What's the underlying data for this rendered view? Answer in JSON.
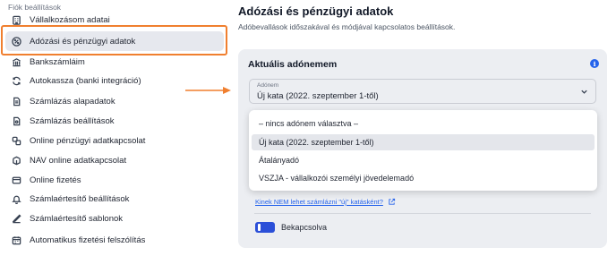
{
  "sidebar": {
    "section_title": "Fiók beállítások",
    "items": [
      {
        "label": "Vállalkozásom adatai",
        "icon": "building-icon"
      },
      {
        "label": "Adózási és pénzügyi adatok",
        "icon": "percent-icon",
        "active": true
      },
      {
        "label": "Bankszámláim",
        "icon": "bank-icon"
      },
      {
        "label": "Autokassza (banki integráció)",
        "icon": "sync-icon"
      },
      {
        "label": "Számlázás alapadatok",
        "icon": "invoice-icon"
      },
      {
        "label": "Számlázás beállítások",
        "icon": "settings-doc-icon"
      },
      {
        "label": "Online pénzügyi adatkapcsolat",
        "icon": "link-icon"
      },
      {
        "label": "NAV online adatkapcsolat",
        "icon": "nav-icon"
      },
      {
        "label": "Online fizetés",
        "icon": "card-icon"
      },
      {
        "label": "Számlaértesítő beállítások",
        "icon": "bell-icon"
      },
      {
        "label": "Számlaértesítő sablonok",
        "icon": "template-icon"
      },
      {
        "label": "Automatikus fizetési felszólítás",
        "icon": "calendar-icon"
      }
    ]
  },
  "main": {
    "title": "Adózási és pénzügyi adatok",
    "subtitle": "Adóbevallások időszakával és módjával kapcsolatos beállítások."
  },
  "card": {
    "title": "Aktuális adónemem",
    "select": {
      "label": "Adónem",
      "value": "Új kata (2022. szeptember 1-től)"
    },
    "options": [
      "– nincs adónem választva –",
      "Új kata (2022. szeptember 1-től)",
      "Átalányadó",
      "VSZJA - vállalkozói személyi jövedelemadó"
    ],
    "selected_option_index": 1,
    "link_text": "Kinek NEM lehet számlázni \"új\" katásként?",
    "toggle_label": "Bekapcsolva",
    "toggle_on": true
  },
  "colors": {
    "highlight": "#f07f2f",
    "accent": "#2b4fd8",
    "link": "#2563eb"
  }
}
